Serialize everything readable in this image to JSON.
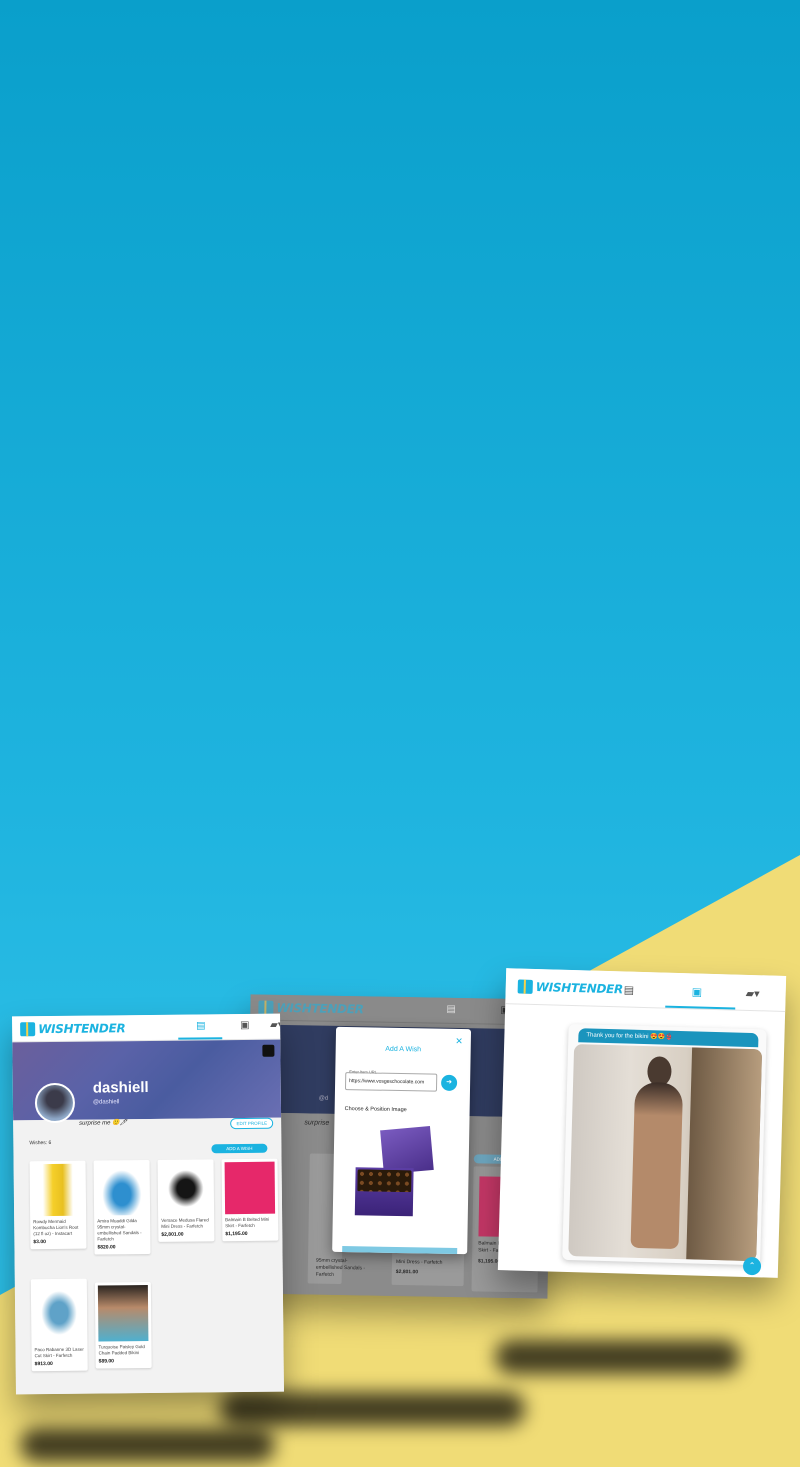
{
  "colors": {
    "sky": "#1fb4df",
    "sand": "#f0dc76",
    "accent": "#1bb3e0"
  },
  "brand": {
    "logo_text": "WISHTENDER"
  },
  "nav_icons": {
    "wishlist": "book-icon",
    "gifts": "cake-icon",
    "account": "account-icon",
    "menu": "chevron-down-icon"
  },
  "profile": {
    "name": "dashiell",
    "handle": "@dashiell",
    "bio": "surprise me 🙂🖊",
    "edit_label": "EDIT PROFILE",
    "wishes_label": "Wishes: 6",
    "add_wish_label": "ADD A WISH",
    "wishes": [
      {
        "title": "Rowdy Mermaid Kombucha Lion's Root (12 fl oz) - Instacart",
        "price": "$3.00"
      },
      {
        "title": "Amira Muaddi Gilda 95mm crystal-embellished Sandals - Farfetch",
        "price": "$820.00"
      },
      {
        "title": "Versace Medusa Flared Mini Dress - Farfetch",
        "price": "$2,801.00"
      },
      {
        "title": "Balmain B Belted Mini Skirt - Farfetch",
        "price": "$1,195.00"
      },
      {
        "title": "Paco Rabanne 3D Laser Cut Skirt - Farfetch",
        "price": "$913.00"
      },
      {
        "title": "Turquoise Paisley Gold Chain Padded Bikini",
        "price": "$89.00"
      }
    ]
  },
  "modal": {
    "title": "Add A Wish",
    "url_label": "Enter Item URL",
    "url_value": "https://www.vosgeschocolate.com",
    "choose_label": "Choose & Position Image",
    "close_icon": "close-icon",
    "go_icon": "arrow-icon"
  },
  "modal_background": {
    "edit_label": "EDIT PROFILE",
    "add_label": "ADD A WISH",
    "bio_fragment": "surprise",
    "handle_fragment": "@d",
    "card_mid_1": "95mm crystal-",
    "card_mid_2": "embellished Sandals -",
    "card_mid_3": "Farfetch",
    "card_dress": "Mini Dress - Farfetch",
    "card_dress_price": "$2,801.00",
    "card_skirt": "Balmain B Belted Mini Skirt - Farfetch",
    "card_skirt_price": "$1,195.00"
  },
  "message": {
    "text": "Thank you for the bikini 😍😍👙"
  }
}
